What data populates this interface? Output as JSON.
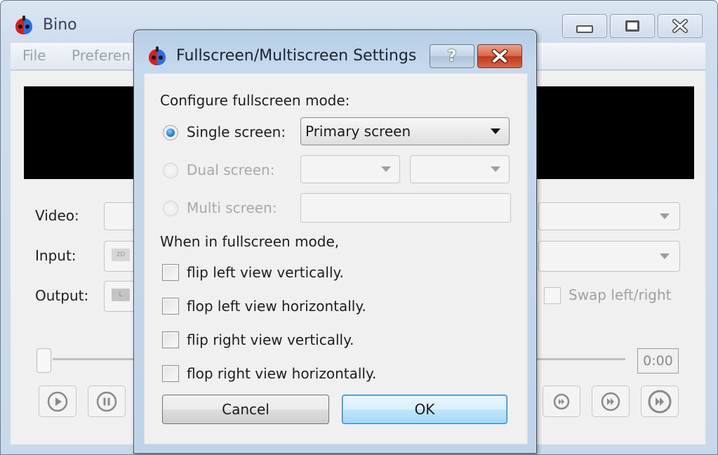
{
  "main_window": {
    "title": "Bino",
    "caption_buttons": [
      "minimize",
      "maximize",
      "close"
    ],
    "menu": [
      "File",
      "Preferen"
    ],
    "labels": {
      "video": "Video:",
      "input": "Input:",
      "output": "Output:"
    },
    "input_badge": "2D",
    "output_badge": "L",
    "swap_label": "Swap left/right",
    "swap_checked": false,
    "time": "0:00",
    "seek_position": 0,
    "media_buttons": [
      "play",
      "pause",
      "forward-small",
      "forward-medium",
      "forward-large"
    ]
  },
  "dialog": {
    "title": "Fullscreen/Multiscreen Settings",
    "help_label": "?",
    "section_configure": "Configure fullscreen mode:",
    "single_screen": {
      "label": "Single screen:",
      "selected": true,
      "enabled": true,
      "value": "Primary screen"
    },
    "dual_screen": {
      "label": "Dual screen:",
      "selected": false,
      "enabled": false,
      "value1": "",
      "value2": ""
    },
    "multi_screen": {
      "label": "Multi screen:",
      "selected": false,
      "enabled": false,
      "value": ""
    },
    "section_when": "When in fullscreen mode,",
    "options": [
      {
        "label": "flip left view vertically.",
        "checked": false
      },
      {
        "label": "flop left view horizontally.",
        "checked": false
      },
      {
        "label": "flip right view vertically.",
        "checked": false
      },
      {
        "label": "flop right view horizontally.",
        "checked": false
      }
    ],
    "cancel_label": "Cancel",
    "ok_label": "OK"
  }
}
